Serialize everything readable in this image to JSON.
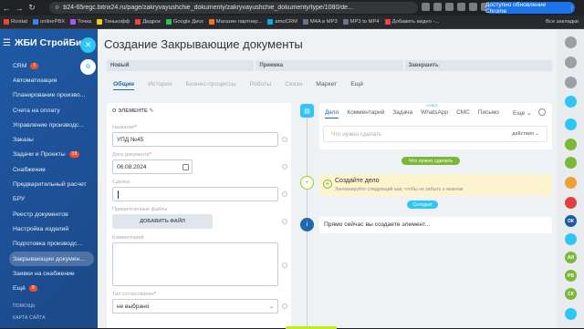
{
  "browser": {
    "url": "b24-65regc.bitrix24.ru/page/zakryvayushchie_dokumenty/zakryvayushchie_dokumenty/type/1080/de...",
    "update_button": "Доступно обновление Chrome",
    "update_menu": "⋮"
  },
  "bookmarks": {
    "items": [
      {
        "label": "Roistat",
        "color": "#e8453c"
      },
      {
        "label": "onlinePBX",
        "color": "#3b82f6"
      },
      {
        "label": "Точка",
        "color": "#a855f7"
      },
      {
        "label": "Тинькофф",
        "color": "#facc15"
      },
      {
        "label": "Дидрок",
        "color": "#ef4444"
      },
      {
        "label": "Google Диск",
        "color": "#22c55e"
      },
      {
        "label": "Магазин партнер...",
        "color": "#f97316"
      },
      {
        "label": "amoCRM",
        "color": "#0ea5e9"
      },
      {
        "label": "M4A в MP3",
        "color": "#64748b"
      },
      {
        "label": "MP3 to MP4",
        "color": "#64748b"
      },
      {
        "label": "Добавить видео -...",
        "color": "#ef4444"
      }
    ],
    "all_bookmarks": "Все закладки"
  },
  "sidebar": {
    "logo": "ЖБИ СтройБи",
    "items": [
      {
        "label": "CRM",
        "badge": "1",
        "active": false
      },
      {
        "label": "Автоматизация",
        "badge": "",
        "active": false
      },
      {
        "label": "Планирование произво...",
        "badge": "",
        "active": false
      },
      {
        "label": "Счета на оплату",
        "badge": "",
        "active": false
      },
      {
        "label": "Управление производс...",
        "badge": "",
        "active": false
      },
      {
        "label": "Заказы",
        "badge": "",
        "active": false
      },
      {
        "label": "Задачи и Проекты",
        "badge": "19",
        "active": false
      },
      {
        "label": "Снабжение",
        "badge": "",
        "active": false
      },
      {
        "label": "Предварительный расчет",
        "badge": "",
        "active": false
      },
      {
        "label": "БРУ",
        "badge": "",
        "active": false
      },
      {
        "label": "Реестр документов",
        "badge": "",
        "active": false
      },
      {
        "label": "Настройка изделий",
        "badge": "",
        "active": false
      },
      {
        "label": "Подготовка производс...",
        "badge": "",
        "active": false
      },
      {
        "label": "Закрывающие докумен...",
        "badge": "",
        "active": true
      },
      {
        "label": "Заявки на снабжение",
        "badge": "",
        "active": false
      },
      {
        "label": "Ещё",
        "badge": "9",
        "active": false
      }
    ],
    "footer": [
      "ПОМОЩЬ",
      "КАРТА САЙТА"
    ]
  },
  "slider": {
    "title": "Создание Закрывающие документы",
    "stages": [
      "Новый",
      "Приемка",
      "Завершить"
    ],
    "tabs": [
      "Общие",
      "История",
      "Бизнес-процессы",
      "Роботы",
      "Связи",
      "Маркет",
      "Ещё"
    ]
  },
  "form": {
    "section_title": "О ЭЛЕМЕНТЕ",
    "name_label": "Название",
    "name_value": "УПД №45",
    "date_label": "Дата документа",
    "date_value": "06.08.2024",
    "deal_label": "Сделка",
    "deal_value": "",
    "files_label": "Прикрепленные файлы",
    "add_file": "ДОБАВИТЬ ФАЙЛ",
    "comment_label": "Комментарий",
    "approval_label": "Тип согласования",
    "approval_value": "не выбрано",
    "required_mark": "*"
  },
  "timeline": {
    "editor_tabs": [
      "Дело",
      "Комментарий",
      "Задача",
      "WhatsApp",
      "СМС",
      "Письмо"
    ],
    "new_badge": "НОВОЕ",
    "editor_more": "Еще",
    "placeholder": "Что нужно сделать",
    "actions": "действия",
    "todo_pill": "Что нужно сделать",
    "todo_title": "Создайте дело",
    "todo_sub": "Запланируйте следующий шаг, чтобы не забыть о важном",
    "today_pill": "Сегодня",
    "info_text": "Прямо сейчас вы создаете элемент..."
  },
  "right_rail": [
    "ОК",
    "АИ",
    "РВ",
    "СК"
  ],
  "colors": {
    "accent": "#2067b0",
    "green": "#9dcf00",
    "today": "#2fc6f6",
    "todo_bg": "#fef3cf"
  }
}
